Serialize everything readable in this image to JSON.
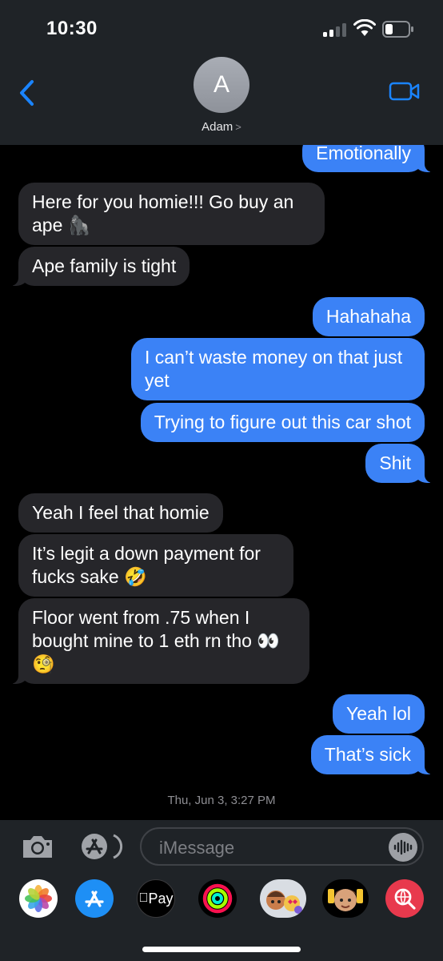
{
  "status_bar": {
    "time": "10:30"
  },
  "header": {
    "avatar_initial": "A",
    "contact_name": "Adam",
    "chevron": ">"
  },
  "messages": [
    {
      "text": "Emotionally",
      "direction": "out"
    },
    {
      "text": "Here for you homie!!! Go buy an ape 🦍",
      "direction": "in"
    },
    {
      "text": "Ape family is tight",
      "direction": "in"
    },
    {
      "text": "Hahahaha",
      "direction": "out"
    },
    {
      "text": "I can’t waste money on that just yet",
      "direction": "out"
    },
    {
      "text": "Trying to figure out this car shot",
      "direction": "out"
    },
    {
      "text": "Shit",
      "direction": "out"
    },
    {
      "text": "Yeah I feel that homie",
      "direction": "in"
    },
    {
      "text": "It’s legit a down payment for fucks sake 🤣",
      "direction": "in"
    },
    {
      "text": "Floor went from .75 when I bought mine to 1 eth rn tho 👀 🧐",
      "direction": "in"
    },
    {
      "text": "Yeah lol",
      "direction": "out"
    },
    {
      "text": "That’s sick",
      "direction": "out"
    }
  ],
  "timestamp": {
    "day": "Thu, Jun 3,",
    "time": "3:27 PM"
  },
  "compose": {
    "placeholder": "iMessage"
  },
  "app_drawer": {
    "apple_pay_label": "Pay"
  },
  "colors": {
    "outgoing": "#3b82f6",
    "incoming": "#26262a",
    "accent": "#1a84ff",
    "bars": "#1f2327"
  }
}
